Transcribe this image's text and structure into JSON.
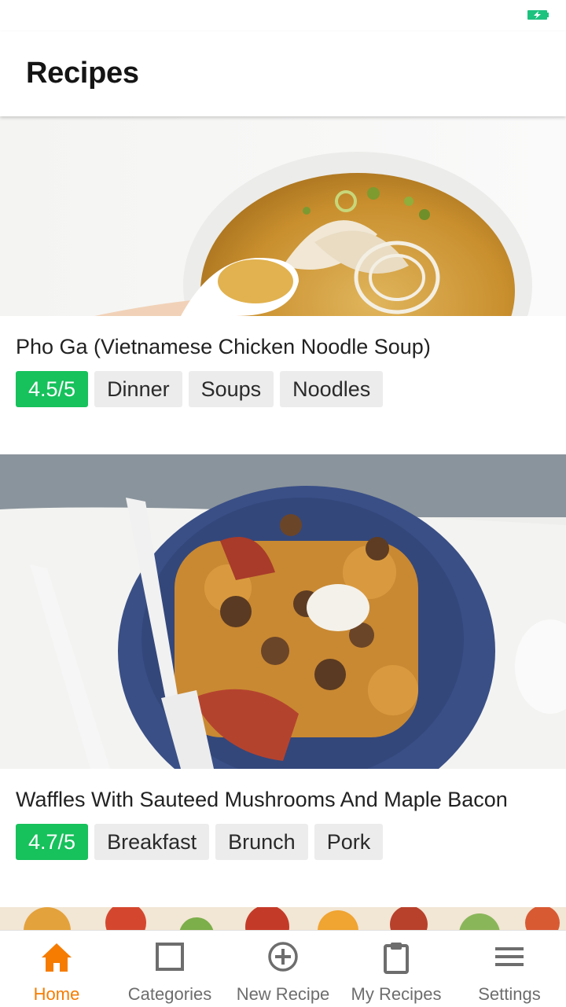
{
  "app": {
    "title": "Recipes"
  },
  "colors": {
    "accent": "#f57c00",
    "rating": "#17c15c",
    "battery": "#1dc27f",
    "tag_bg": "#ececec"
  },
  "recipes": [
    {
      "title": "Pho Ga (Vietnamese Chicken Noodle Soup)",
      "rating": "4.5/5",
      "tags": [
        "Dinner",
        "Soups",
        "Noodles"
      ],
      "image": "soup-bowl-image"
    },
    {
      "title": "Waffles With Sauteed Mushrooms And Maple Bacon",
      "rating": "4.7/5",
      "tags": [
        "Breakfast",
        "Brunch",
        "Pork"
      ],
      "image": "waffles-plate-image"
    }
  ],
  "nav": {
    "items": [
      {
        "label": "Home",
        "icon": "home-icon",
        "active": true
      },
      {
        "label": "Categories",
        "icon": "square-icon",
        "active": false
      },
      {
        "label": "New Recipe",
        "icon": "add-circle-icon",
        "active": false
      },
      {
        "label": "My Recipes",
        "icon": "clipboard-icon",
        "active": false
      },
      {
        "label": "Settings",
        "icon": "menu-icon",
        "active": false
      }
    ]
  }
}
